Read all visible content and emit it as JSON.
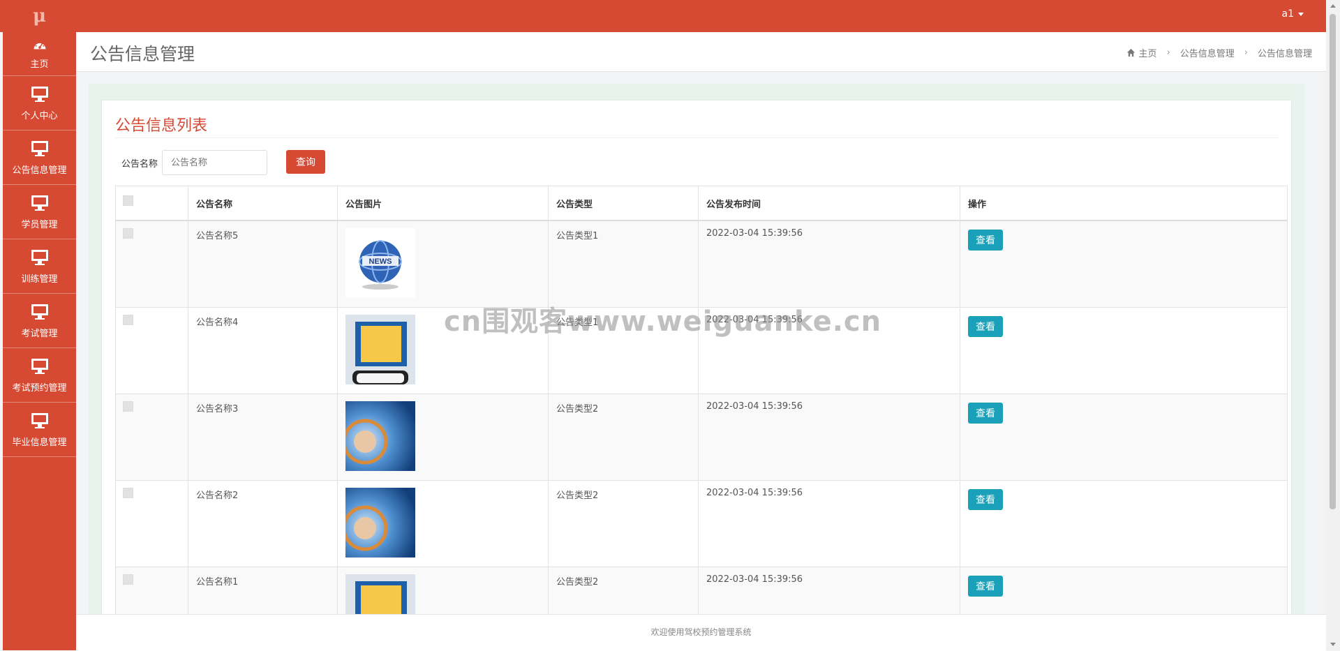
{
  "app": {
    "logo": "μ",
    "user": "a1"
  },
  "sidebar": {
    "items": [
      {
        "label": "主页",
        "icon": "dashboard-icon"
      },
      {
        "label": "个人中心",
        "icon": "monitor-icon"
      },
      {
        "label": "公告信息管理",
        "icon": "monitor-icon"
      },
      {
        "label": "学员管理",
        "icon": "monitor-icon"
      },
      {
        "label": "训练管理",
        "icon": "monitor-icon"
      },
      {
        "label": "考试管理",
        "icon": "monitor-icon"
      },
      {
        "label": "考试预约管理",
        "icon": "monitor-icon"
      },
      {
        "label": "毕业信息管理",
        "icon": "monitor-icon"
      }
    ]
  },
  "header": {
    "title": "公告信息管理",
    "breadcrumb": [
      "主页",
      "公告信息管理",
      "公告信息管理"
    ]
  },
  "card": {
    "title": "公告信息列表"
  },
  "filter": {
    "label": "公告名称",
    "placeholder": "公告名称",
    "query_label": "查询"
  },
  "table": {
    "columns": [
      "",
      "公告名称",
      "公告图片",
      "公告类型",
      "公告发布时间",
      "操作"
    ],
    "view_label": "查看",
    "rows": [
      {
        "name": "公告名称5",
        "image": "globe-news",
        "type": "公告类型1",
        "time": "2022-03-04 15:39:56"
      },
      {
        "name": "公告名称4",
        "image": "breaking-news",
        "type": "公告类型1",
        "time": "2022-03-04 15:39:56"
      },
      {
        "name": "公告名称3",
        "image": "blue-news",
        "type": "公告类型2",
        "time": "2022-03-04 15:39:56"
      },
      {
        "name": "公告名称2",
        "image": "blue-news",
        "type": "公告类型2",
        "time": "2022-03-04 15:39:56"
      },
      {
        "name": "公告名称1",
        "image": "breaking-news",
        "type": "公告类型2",
        "time": "2022-03-04 15:39:56"
      }
    ]
  },
  "watermark": "cn围观客www.weiguanke.cn",
  "footer": {
    "text": "欢迎使用驾校预约管理系统"
  },
  "colors": {
    "primary": "#d64a33",
    "info": "#1aa1b9",
    "content_bg": "#e9f3ee"
  }
}
